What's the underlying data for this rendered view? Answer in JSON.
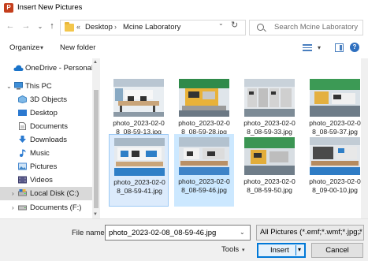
{
  "window": {
    "title": "Insert New Pictures",
    "app_icon_letter": "P"
  },
  "address": {
    "overflow": "«",
    "crumbs": [
      "Desktop",
      "Mcine Laboratory"
    ],
    "separator": "›",
    "dropdown_glyph": "⌄",
    "refresh_glyph": "↻"
  },
  "nav_glyphs": {
    "back": "←",
    "forward": "→",
    "recent": "⌄",
    "up": "↑"
  },
  "search": {
    "placeholder": "Search Mcine Laboratory"
  },
  "toolbar": {
    "organize": "Organize",
    "organize_arrow": "▾",
    "new_folder": "New folder",
    "view_arrow": "▾",
    "help": "?"
  },
  "sidebar": {
    "items": [
      {
        "label": "OneDrive - Personal",
        "icon": "onedrive-icon"
      },
      {
        "label": "This PC",
        "icon": "pc-icon"
      },
      {
        "label": "3D Objects",
        "icon": "3d-objects-icon"
      },
      {
        "label": "Desktop",
        "icon": "desktop-icon"
      },
      {
        "label": "Documents",
        "icon": "documents-icon"
      },
      {
        "label": "Downloads",
        "icon": "downloads-icon"
      },
      {
        "label": "Music",
        "icon": "music-icon"
      },
      {
        "label": "Pictures",
        "icon": "pictures-icon"
      },
      {
        "label": "Videos",
        "icon": "videos-icon"
      },
      {
        "label": "Local Disk (C:)",
        "icon": "disk-icon",
        "selected": true
      },
      {
        "label": "Documents (F:)",
        "icon": "drive-icon"
      }
    ],
    "expand_glyph": "›",
    "expanded_glyph": "⌄"
  },
  "files": [
    {
      "name": "photo_2023-02-08_08-59-13.jpg",
      "line1": "photo_2023-02-0",
      "line2": "8_08-59-13.jpg",
      "state": "normal"
    },
    {
      "name": "photo_2023-02-08_08-59-28.jpg",
      "line1": "photo_2023-02-0",
      "line2": "8_08-59-28.jpg",
      "state": "normal"
    },
    {
      "name": "photo_2023-02-08_08-59-33.jpg",
      "line1": "photo_2023-02-0",
      "line2": "8_08-59-33.jpg",
      "state": "normal"
    },
    {
      "name": "photo_2023-02-08_08-59-37.jpg",
      "line1": "photo_2023-02-0",
      "line2": "8_08-59-37.jpg",
      "state": "normal"
    },
    {
      "name": "photo_2023-02-08_08-59-41.jpg",
      "line1": "photo_2023-02-0",
      "line2": "8_08-59-41.jpg",
      "state": "hover"
    },
    {
      "name": "photo_2023-02-08_08-59-46.jpg",
      "line1": "photo_2023-02-0",
      "line2": "8_08-59-46.jpg",
      "state": "selected"
    },
    {
      "name": "photo_2023-02-08_08-59-50.jpg",
      "line1": "photo_2023-02-0",
      "line2": "8_08-59-50.jpg",
      "state": "normal"
    },
    {
      "name": "photo_2023-02-08_09-00-10.jpg",
      "line1": "photo_2023-02-0",
      "line2": "8_09-00-10.jpg",
      "state": "normal"
    }
  ],
  "bottom": {
    "file_name_label": "File name:",
    "file_name_value": "photo_2023-02-08_08-59-46.jpg",
    "filter": "All Pictures (*.emf;*.wmf;*.jpg;*",
    "tools": "Tools",
    "insert": "Insert",
    "cancel": "Cancel",
    "dropdown_glyph": "⌄",
    "split_arrow": "▾"
  },
  "colors": {
    "accent": "#0078d7",
    "selected_bg": "#cce8ff",
    "hover_bg": "#dcebfc",
    "folder": "#f3c64b"
  }
}
